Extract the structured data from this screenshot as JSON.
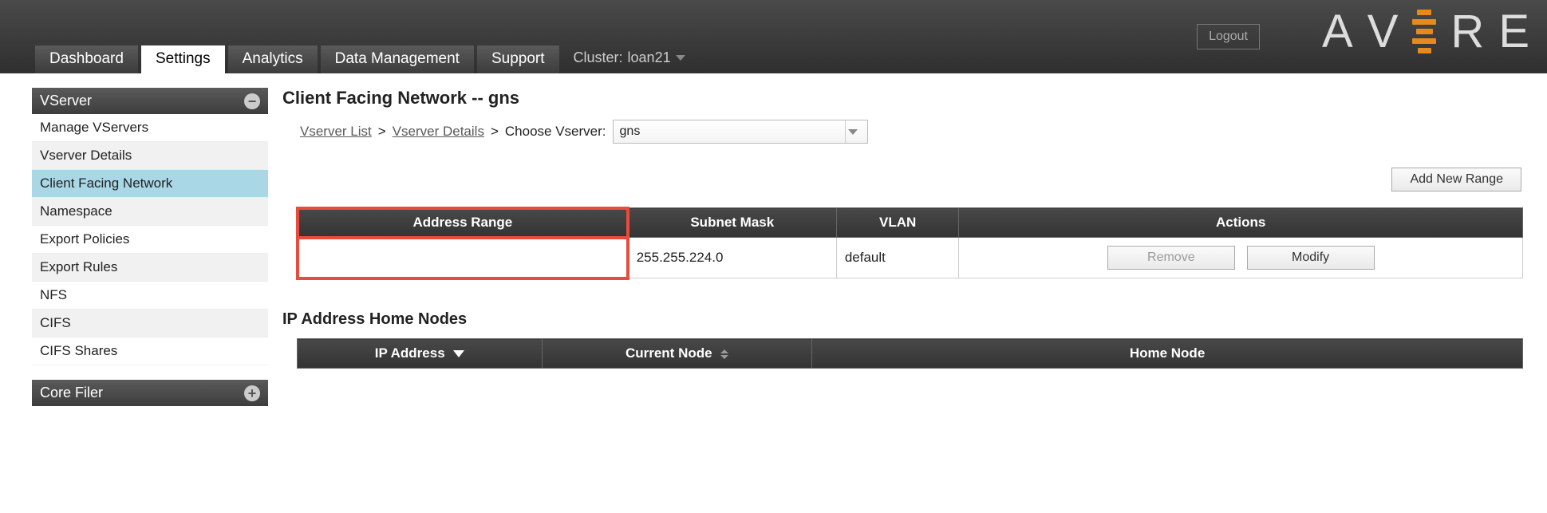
{
  "header": {
    "logout": "Logout",
    "logo_letters": [
      "A",
      "V",
      "R",
      "E"
    ],
    "cluster_prefix": "Cluster:",
    "cluster_name": "loan21"
  },
  "nav": {
    "tabs": [
      {
        "label": "Dashboard"
      },
      {
        "label": "Settings",
        "active": true
      },
      {
        "label": "Analytics"
      },
      {
        "label": "Data Management"
      },
      {
        "label": "Support"
      }
    ]
  },
  "sidebar": {
    "section1": {
      "title": "VServer",
      "icon": "−"
    },
    "items": [
      {
        "label": "Manage VServers"
      },
      {
        "label": "Vserver Details"
      },
      {
        "label": "Client Facing Network",
        "selected": true
      },
      {
        "label": "Namespace"
      },
      {
        "label": "Export Policies"
      },
      {
        "label": "Export Rules"
      },
      {
        "label": "NFS"
      },
      {
        "label": "CIFS"
      },
      {
        "label": "CIFS Shares"
      }
    ],
    "section2": {
      "title": "Core Filer",
      "icon": "+"
    }
  },
  "main": {
    "title": "Client Facing Network -- gns",
    "crumbs": {
      "vserver_list": "Vserver List",
      "sep": ">",
      "vserver_details": "Vserver Details",
      "choose": "Choose Vserver:"
    },
    "vserver_select": "gns",
    "add_range_btn": "Add New Range",
    "range_table": {
      "headers": [
        "Address Range",
        "Subnet Mask",
        "VLAN",
        "Actions"
      ],
      "row": {
        "address_range": "",
        "subnet_mask": "255.255.224.0",
        "vlan": "default",
        "remove": "Remove",
        "modify": "Modify"
      }
    },
    "ip_section_title": "IP Address Home Nodes",
    "ip_table": {
      "headers": [
        "IP Address",
        "Current Node",
        "Home Node"
      ]
    }
  }
}
